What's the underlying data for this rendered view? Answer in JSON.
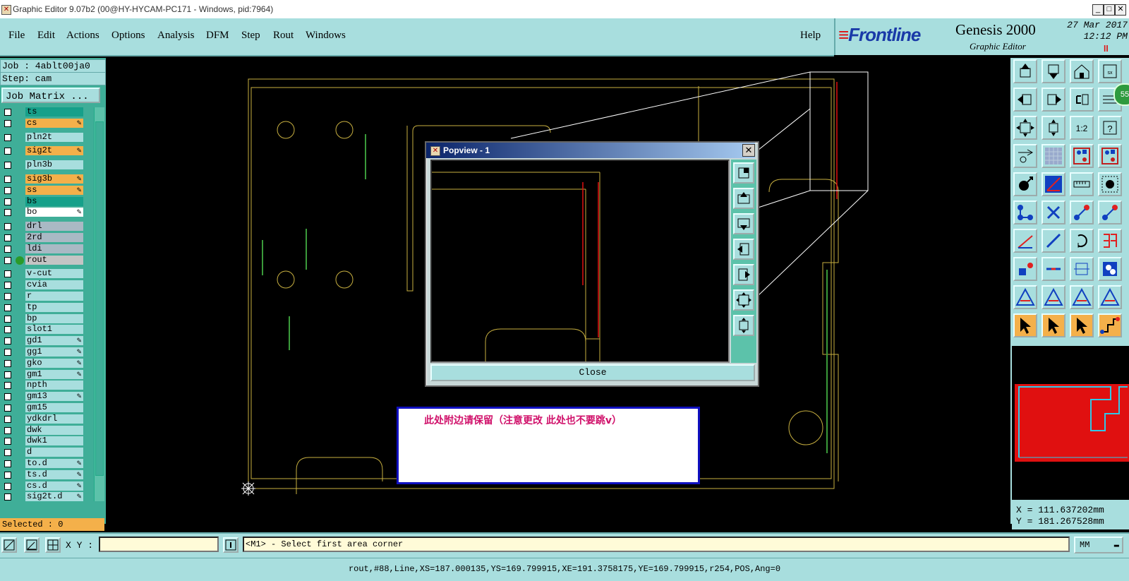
{
  "window": {
    "title": "Graphic Editor 9.07b2 (00@HY-HYCAM-PC171 - Windows, pid:7964)"
  },
  "menu": {
    "items": [
      "File",
      "Edit",
      "Actions",
      "Options",
      "Analysis",
      "DFM",
      "Step",
      "Rout",
      "Windows"
    ],
    "help": "Help"
  },
  "brand": {
    "logo": "Frontline",
    "product": "Genesis 2000",
    "subtitle": "Graphic Editor",
    "date": "27 Mar 2017",
    "time": "12:12 PM"
  },
  "job": {
    "job_line": "Job : 4ablt00ja0",
    "step_line": "Step: cam",
    "matrix_button": "Job Matrix ..."
  },
  "layers": [
    {
      "name": "ts",
      "color": "teal",
      "pen": false
    },
    {
      "name": "cs",
      "color": "orange",
      "pen": true
    },
    {
      "name": "pln2t",
      "color": "light",
      "pen": false
    },
    {
      "name": "sig2t",
      "color": "orange",
      "pen": true
    },
    {
      "name": "pln3b",
      "color": "light",
      "pen": false
    },
    {
      "name": "sig3b",
      "color": "orange",
      "pen": true
    },
    {
      "name": "ss",
      "color": "orange",
      "pen": true
    },
    {
      "name": "bs",
      "color": "teal",
      "pen": false
    },
    {
      "name": "bo",
      "color": "white",
      "pen": true
    },
    {
      "name": "drl",
      "color": "gray",
      "pen": false
    },
    {
      "name": "2rd",
      "color": "gray",
      "pen": false
    },
    {
      "name": "ldi",
      "color": "gray",
      "pen": false
    },
    {
      "name": "rout",
      "color": "gray2",
      "pen": false,
      "active": true
    },
    {
      "name": "v-cut",
      "color": "light",
      "pen": false
    },
    {
      "name": "cvia",
      "color": "light",
      "pen": false
    },
    {
      "name": "r",
      "color": "light",
      "pen": false
    },
    {
      "name": "tp",
      "color": "light",
      "pen": false
    },
    {
      "name": "bp",
      "color": "light",
      "pen": false
    },
    {
      "name": "slot1",
      "color": "light",
      "pen": false
    },
    {
      "name": "gd1",
      "color": "light",
      "pen": true
    },
    {
      "name": "gg1",
      "color": "light",
      "pen": true
    },
    {
      "name": "gko",
      "color": "light",
      "pen": true
    },
    {
      "name": "gm1",
      "color": "light",
      "pen": true
    },
    {
      "name": "npth",
      "color": "light",
      "pen": false
    },
    {
      "name": "gm13",
      "color": "light",
      "pen": true
    },
    {
      "name": "gm15",
      "color": "light",
      "pen": false
    },
    {
      "name": "ydkdrl",
      "color": "light",
      "pen": false
    },
    {
      "name": "dwk",
      "color": "light",
      "pen": false
    },
    {
      "name": "dwk1",
      "color": "light",
      "pen": false
    },
    {
      "name": "d",
      "color": "light",
      "pen": false
    },
    {
      "name": "to.d",
      "color": "light",
      "pen": true
    },
    {
      "name": "ts.d",
      "color": "light",
      "pen": true
    },
    {
      "name": "cs.d",
      "color": "light",
      "pen": true
    },
    {
      "name": "sig2t.d",
      "color": "light",
      "pen": true
    }
  ],
  "selected": "Selected : 0",
  "coords": {
    "x": "X = 111.637202mm",
    "y": "Y = 181.267528mm"
  },
  "toolbar_badge": "55",
  "cmd": {
    "xy_label": "X Y :",
    "xy_value": "",
    "prompt": "<M1> - Select first area corner",
    "units": "MM"
  },
  "status": "rout,#88,Line,XS=187.000135,YS=169.799915,XE=191.3758175,YE=169.799915,r254,POS,Ang=0",
  "popview": {
    "title": "Popview - 1",
    "close": "Close"
  },
  "note": {
    "text": "此处附边请保留（注意更改   此处也不要跳v）"
  },
  "colors": {
    "panel": "#a8dede",
    "teal": "#16a08a",
    "orange": "#f4b04a",
    "outline": "#c8b040",
    "rout_red": "#e01010"
  }
}
